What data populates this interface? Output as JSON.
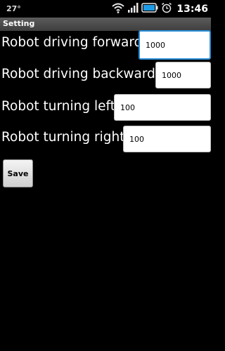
{
  "status_bar": {
    "temperature": "27°",
    "time": "13:46",
    "icons": [
      "wifi-icon",
      "signal-icon",
      "battery-icon",
      "alarm-icon"
    ]
  },
  "title_bar": {
    "title": "Setting"
  },
  "form": {
    "fields": [
      {
        "label": "Robot driving forward:",
        "value": "1000"
      },
      {
        "label": "Robot driving backwards:",
        "value": "1000"
      },
      {
        "label": "Robot turning left:",
        "value": "100"
      },
      {
        "label": "Robot turning right:",
        "value": "100"
      }
    ],
    "save_label": "Save"
  },
  "colors": {
    "background": "#000000",
    "title_bar": "#4a4a4a",
    "focus_border": "#2a8fd8",
    "text": "#ffffff"
  }
}
